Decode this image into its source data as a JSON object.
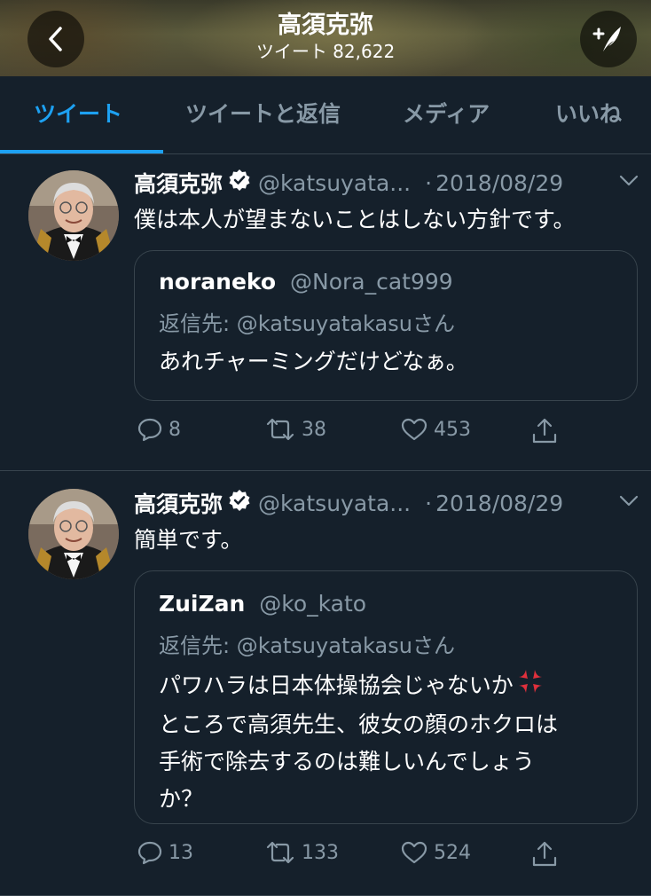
{
  "header": {
    "title": "高須克弥",
    "subtitle": "ツイート 82,622",
    "back_icon": "chevron-left-icon",
    "compose_icon": "compose-feather-icon"
  },
  "tabs": [
    {
      "label": "ツイート",
      "active": true
    },
    {
      "label": "ツイートと返信",
      "active": false
    },
    {
      "label": "メディア",
      "active": false
    },
    {
      "label": "いいね",
      "active": false
    }
  ],
  "tweets": [
    {
      "name": "高須克弥",
      "handle": "@katsuyata...",
      "dot": "·",
      "date": "2018/08/29",
      "text": "僕は本人が望まないことはしない方針です。",
      "quote": {
        "name": "noraneko",
        "handle": "@Nora_cat999",
        "reply_to": "返信先: @katsuyatakasuさん",
        "text_lines": [
          "あれチャーミングだけどなぁ。"
        ]
      },
      "replies": "8",
      "retweets": "38",
      "likes": "453"
    },
    {
      "name": "高須克弥",
      "handle": "@katsuyata...",
      "dot": "·",
      "date": "2018/08/29",
      "text": "簡単です。",
      "quote": {
        "name": "ZuiZan",
        "handle": "@ko_kato",
        "reply_to": "返信先: @katsuyatakasuさん",
        "text_lines": [
          "パワハラは日本体操協会じゃないか",
          "ところで高須先生、彼女の顔のホクロは",
          "手術で除去するのは難しいんでしょう",
          "か？"
        ]
      },
      "replies": "13",
      "retweets": "133",
      "likes": "524"
    }
  ],
  "colors": {
    "background": "#15202b",
    "accent": "#1da1f2",
    "muted": "#8899a6",
    "border": "#38444d"
  }
}
